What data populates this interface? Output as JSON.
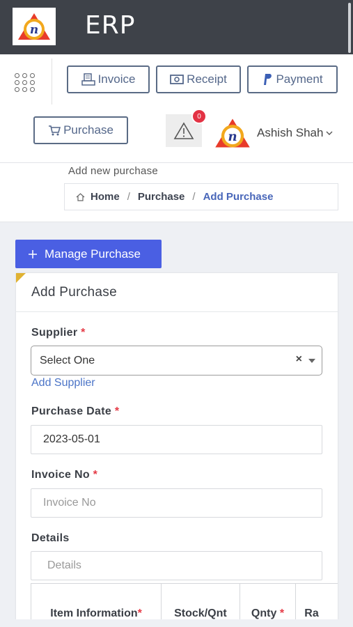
{
  "app": {
    "title": "ERP"
  },
  "toolbar": {
    "invoice_label": "Invoice",
    "receipt_label": "Receipt",
    "payment_label": "Payment",
    "purchase_label": "Purchase",
    "alert_count": "0"
  },
  "user": {
    "name": "Ashish Shah"
  },
  "page": {
    "subtitle": "Add new purchase",
    "breadcrumb": [
      "Home",
      "Purchase",
      "Add Purchase"
    ]
  },
  "actions": {
    "manage_label": "Manage Purchase"
  },
  "form": {
    "title": "Add Purchase",
    "supplier": {
      "label": "Supplier",
      "required": "*",
      "value": "Select One",
      "clear": "×",
      "add_link": "Add Supplier"
    },
    "purchase_date": {
      "label": "Purchase Date",
      "required": "*",
      "value": "2023-05-01"
    },
    "invoice_no": {
      "label": "Invoice No",
      "required": "*",
      "placeholder": "Invoice No"
    },
    "details": {
      "label": "Details",
      "placeholder": "Details"
    }
  },
  "table": {
    "columns": [
      "Item Information",
      "Stock/Qnt",
      "Qnty",
      "Ra"
    ],
    "required": [
      "*",
      "",
      "*",
      ""
    ]
  },
  "colors": {
    "topbar": "#3e4249",
    "primary": "#4a5fe3",
    "accent_link": "#4866b9",
    "required": "#e53a46",
    "badge": "#e33244"
  }
}
